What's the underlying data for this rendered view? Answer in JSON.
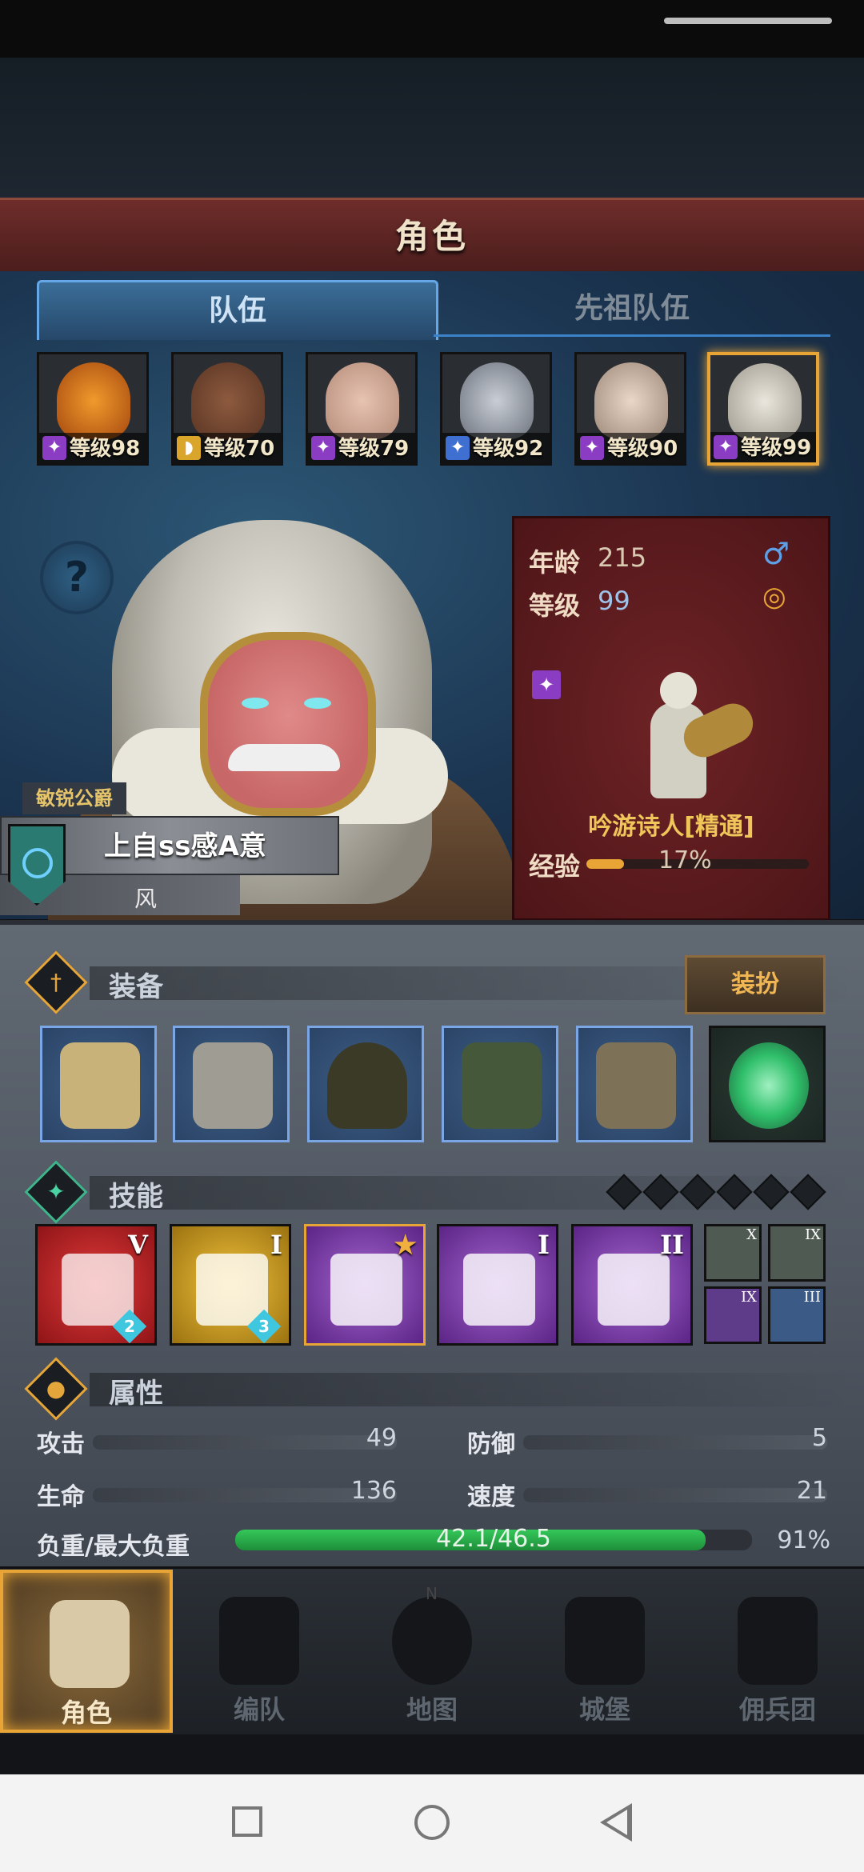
{
  "header": {
    "title": "角色"
  },
  "tabs": [
    {
      "label": "队伍",
      "active": true
    },
    {
      "label": "先祖队伍",
      "active": false
    }
  ],
  "party": [
    {
      "level_label": "等级98",
      "class_icon": "staff-icon",
      "face": "pumpkin"
    },
    {
      "level_label": "等级70",
      "class_icon": "shield-icon",
      "face": "dark"
    },
    {
      "level_label": "等级79",
      "class_icon": "staff-icon",
      "face": "elf-flowers"
    },
    {
      "level_label": "等级92",
      "class_icon": "sword-icon",
      "face": "helmet"
    },
    {
      "level_label": "等级90",
      "class_icon": "staff-icon",
      "face": "elf-hat"
    },
    {
      "level_label": "等级99",
      "class_icon": "staff-icon",
      "face": "hood",
      "selected": true
    }
  ],
  "help": {
    "symbol": "?"
  },
  "character": {
    "title": "敏锐公爵",
    "name": "上自ss感A意",
    "origin": "风",
    "info": {
      "age_label": "年龄",
      "age": "215",
      "gender_symbol": "♂",
      "level_label": "等级",
      "level": "99",
      "class_name": "吟游诗人[精通]",
      "exp_label": "经验",
      "exp_pct": "17%",
      "exp_fraction": 0.17
    }
  },
  "sections": {
    "equipment": "装备",
    "skills": "技能",
    "attributes": "属性"
  },
  "dress_button": "装扮",
  "equipment_slots": [
    {
      "name": "weapon-main",
      "color": "#c9b27a"
    },
    {
      "name": "weapon-off",
      "color": "#9f9c94"
    },
    {
      "name": "hood",
      "color": "#3b3a26"
    },
    {
      "name": "armor",
      "color": "#46583a"
    },
    {
      "name": "boots",
      "color": "#7d7158"
    },
    {
      "name": "ring",
      "color": "#2fbf6a"
    }
  ],
  "skills": [
    {
      "rank": "V",
      "bg": "#c3262a",
      "gem": "2"
    },
    {
      "rank": "I",
      "bg": "#d8a222",
      "gem": "3"
    },
    {
      "rank": "",
      "bg": "#7b3aa6",
      "gem": ""
    },
    {
      "rank": "I",
      "bg": "#7b3aa6",
      "gem": ""
    },
    {
      "rank": "II",
      "bg": "#7b3aa6",
      "gem": ""
    }
  ],
  "passives": [
    {
      "rank": "X",
      "bg": "#4f5a52"
    },
    {
      "rank": "IX",
      "bg": "#4f5a52"
    },
    {
      "rank": "IX",
      "bg": "#5e3c8a"
    },
    {
      "rank": "III",
      "bg": "#3c5a86"
    }
  ],
  "attributes": {
    "attack_label": "攻击",
    "attack": "49",
    "defense_label": "防御",
    "defense": "5",
    "hp_label": "生命",
    "hp": "136",
    "speed_label": "速度",
    "speed": "21",
    "load_label": "负重/最大负重",
    "load": "42.1/46.5",
    "load_pct": "91%",
    "load_fraction": 0.91
  },
  "nav": [
    {
      "label": "角色",
      "active": true
    },
    {
      "label": "编队",
      "active": false
    },
    {
      "label": "地图",
      "active": false
    },
    {
      "label": "城堡",
      "active": false
    },
    {
      "label": "佣兵团",
      "active": false
    }
  ],
  "compass_n": "N"
}
